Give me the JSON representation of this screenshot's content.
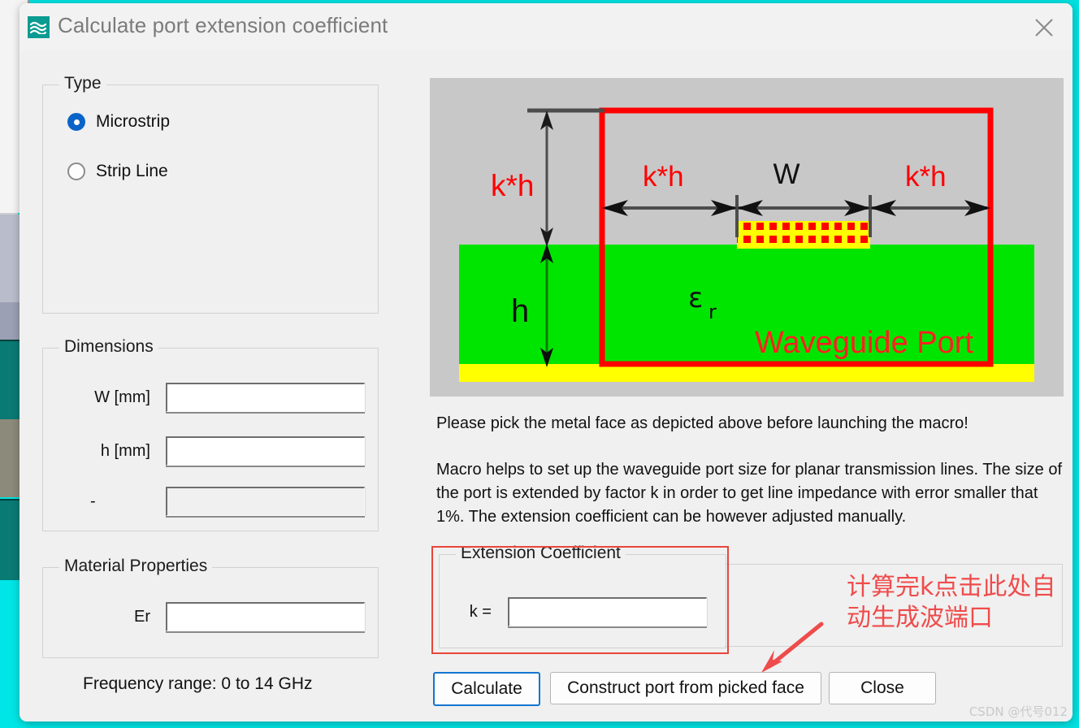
{
  "window": {
    "title": "Calculate port extension coefficient",
    "icon": "waves-icon",
    "close_icon": "close-icon"
  },
  "type_group": {
    "legend": "Type",
    "options": [
      {
        "label": "Microstrip",
        "selected": true
      },
      {
        "label": "Strip Line",
        "selected": false
      }
    ]
  },
  "dimensions_group": {
    "legend": "Dimensions",
    "fields": [
      {
        "label": "W [mm]",
        "value": "",
        "disabled": false
      },
      {
        "label": "h [mm]",
        "value": "",
        "disabled": false
      },
      {
        "label": "-",
        "value": "",
        "disabled": true
      }
    ]
  },
  "material_group": {
    "legend": "Material Properties",
    "fields": [
      {
        "label": "Er",
        "value": "",
        "disabled": false
      }
    ]
  },
  "frequency_text": "Frequency range: 0 to 14 GHz",
  "figure": {
    "labels": {
      "kh_vertical": "k*h",
      "kh_left": "k*h",
      "width": "W",
      "kh_right": "k*h",
      "h": "h",
      "epsilon": "ε",
      "epsilon_sub": "r",
      "port": "Waveguide Port"
    },
    "colors": {
      "background": "#c8c8c8",
      "substrate": "#00e500",
      "ground": "#ffff00",
      "port_outline": "#ff0000",
      "metal_fill": "#ffff00",
      "metal_hatch": "#ff0000",
      "dimension_line": "#4d4d4d"
    }
  },
  "description": {
    "line1": "Please pick the metal face as depicted above before launching the macro!",
    "paragraph": "Macro helps to set up the waveguide port size for planar transmission lines. The size of the port is extended by factor k in order to get line impedance with error smaller that 1%. The extension coefficient can be however adjusted manually."
  },
  "extension_group": {
    "legend": "Extension Coefficient",
    "field_label": "k =",
    "field_value": "",
    "highlight_color": "#e8453c"
  },
  "annotation": {
    "text": "计算完k点击此处自动生成波端口",
    "color": "#ef4b4b",
    "arrow_icon": "arrow-down-left-icon"
  },
  "buttons": {
    "calculate": "Calculate",
    "construct": "Construct port from picked face",
    "close": "Close"
  },
  "watermark": "CSDN @代号012"
}
